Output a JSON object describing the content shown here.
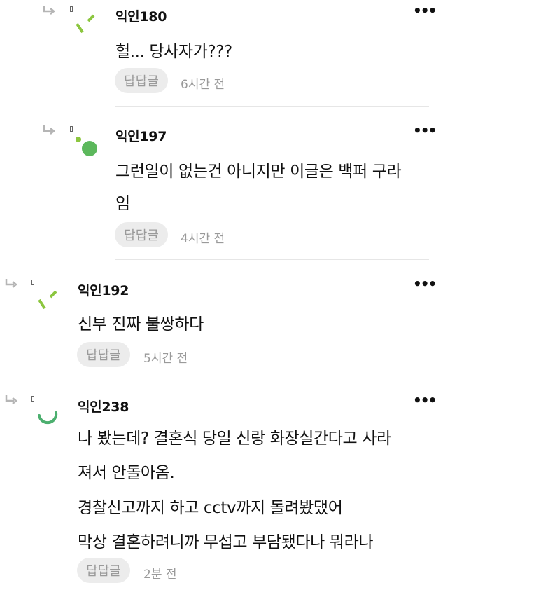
{
  "comments": [
    {
      "author": "익인180",
      "lines": [
        "헐... 당사자가???"
      ],
      "reply_label": "답답글",
      "time": "6시간 전",
      "avatar_color": "#8cc63f"
    },
    {
      "author": "익인197",
      "lines": [
        "그런일이 없는건 아니지만 이글은 백퍼 구라",
        "임"
      ],
      "reply_label": "답답글",
      "time": "4시간 전",
      "avatar_color": "#5cb85c"
    },
    {
      "author": "익인192",
      "lines": [
        "신부 진짜 불쌍하다"
      ],
      "reply_label": "답답글",
      "time": "5시간 전",
      "avatar_color": "#8cc63f"
    },
    {
      "author": "익인238",
      "lines": [
        "나 봤는데? 결혼식 당일 신랑 화장실간다고 사라",
        "져서 안돌아옴.",
        "경찰신고까지 하고 cctv까지 돌려봤댔어",
        "막상 결혼하려니까 무섭고 부담됐다나 뭐라나"
      ],
      "reply_label": "답답글",
      "time": "2분 전",
      "avatar_color": "#4caf6f"
    }
  ],
  "more_label": "•••"
}
